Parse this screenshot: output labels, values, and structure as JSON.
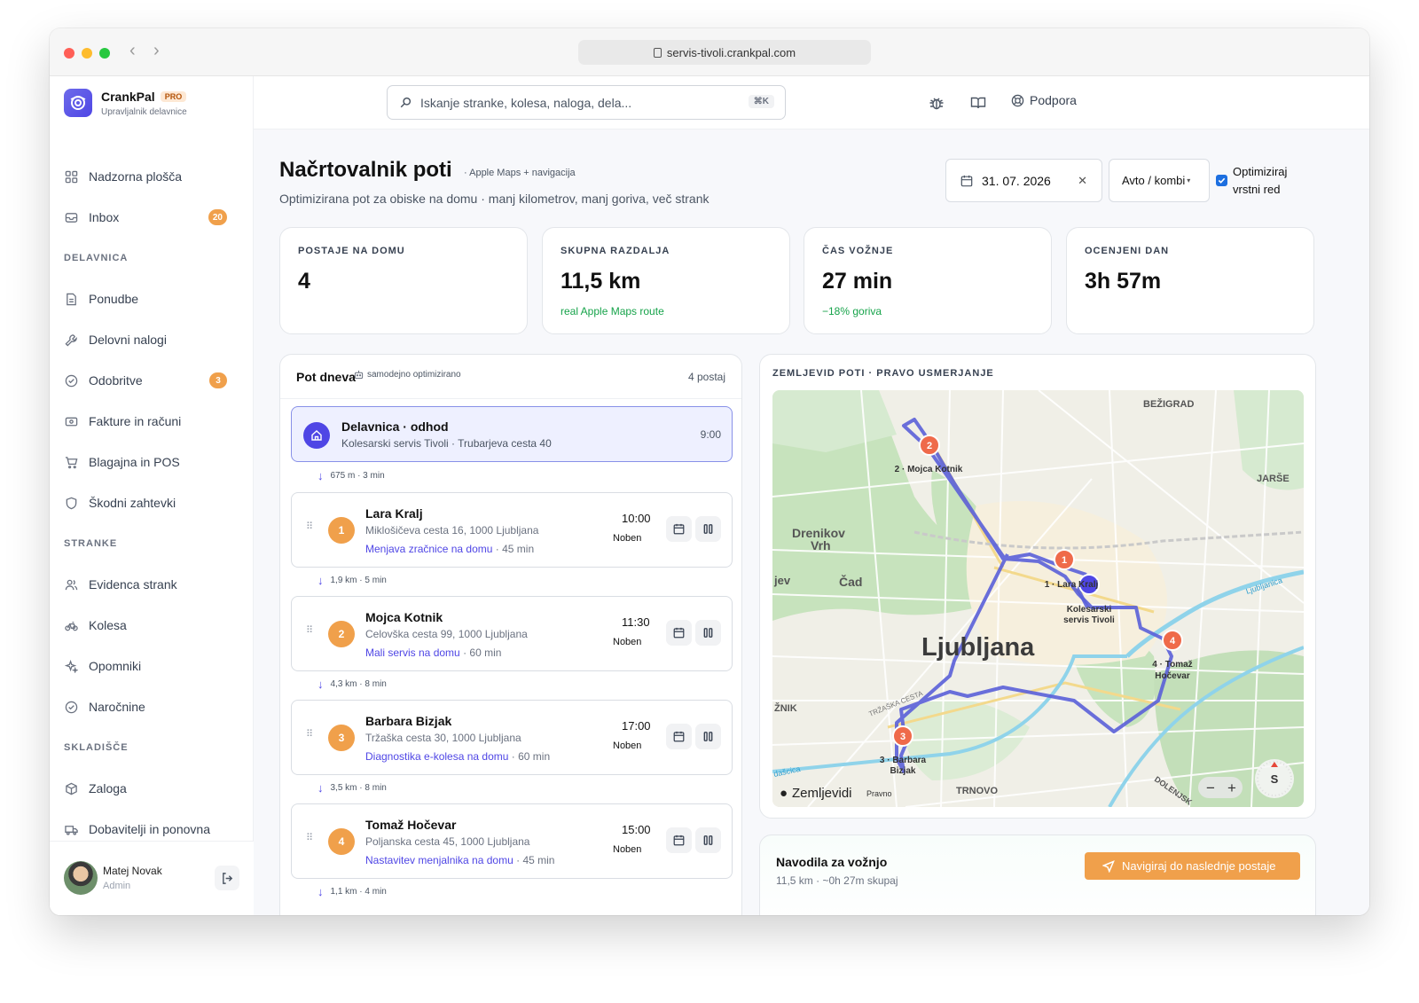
{
  "browser": {
    "url": "servis-tivoli.crankpal.com"
  },
  "brand": {
    "name": "CrankPal",
    "tier": "PRO",
    "subtitle": "Upravljalnik delavnice"
  },
  "sidebar": {
    "items": [
      {
        "label": "Nadzorna plošča",
        "icon": "dashboard-icon"
      },
      {
        "label": "Inbox",
        "icon": "inbox-icon",
        "badge": "20"
      },
      {
        "section": "DELAVNICA"
      },
      {
        "label": "Ponudbe",
        "icon": "document-icon"
      },
      {
        "label": "Delovni nalogi",
        "icon": "wrench-icon"
      },
      {
        "label": "Odobritve",
        "icon": "check-circle-icon",
        "badge": "3"
      },
      {
        "label": "Fakture in računi",
        "icon": "invoice-icon"
      },
      {
        "label": "Blagajna in POS",
        "icon": "cart-icon"
      },
      {
        "label": "Škodni zahtevki",
        "icon": "shield-icon"
      },
      {
        "section": "STRANKE"
      },
      {
        "label": "Evidenca strank",
        "icon": "users-icon"
      },
      {
        "label": "Kolesa",
        "icon": "bike-icon"
      },
      {
        "label": "Opomniki",
        "icon": "sparkle-icon"
      },
      {
        "label": "Naročnine",
        "icon": "check-circle-icon"
      },
      {
        "section": "SKLADIŠČE"
      },
      {
        "label": "Zaloga",
        "icon": "box-icon"
      },
      {
        "label": "Dobavitelji in ponovna",
        "icon": "truck-icon"
      }
    ]
  },
  "user": {
    "name": "Matej Novak",
    "role": "Admin"
  },
  "topbar": {
    "search_placeholder": "Iskanje stranke, kolesa, naloga, dela...",
    "shortcut": "⌘K",
    "support_label": "Podpora"
  },
  "page": {
    "title": "Načrtovalnik poti",
    "title_note": "· Apple Maps + navigacija",
    "subtitle": "Optimizirana pot za obiske na domu · manj kilometrov, manj goriva, več strank",
    "date": "31. 07. 2026",
    "vehicle": "Avto / kombi",
    "optimize_label_1": "Optimiziraj",
    "optimize_label_2": "vrstni red",
    "optimize_checked": true
  },
  "stats": [
    {
      "label": "POSTAJE NA DOMU",
      "value": "4",
      "note": ""
    },
    {
      "label": "SKUPNA RAZDALJA",
      "value": "11,5 km",
      "note": "real Apple Maps route"
    },
    {
      "label": "ČAS VOŽNJE",
      "value": "27 min",
      "note": "−18% goriva"
    },
    {
      "label": "OCENJENI DAN",
      "value": "3h 57m",
      "note": ""
    }
  ],
  "route": {
    "title": "Pot dneva",
    "auto_note": "samodejno optimizirano",
    "count": "4 postaj",
    "depot": {
      "title": "Delavnica · odhod",
      "address": "Kolesarski servis Tivoli · Trubarjeva cesta 40",
      "time": "9:00"
    },
    "legs": [
      "675 m · 3 min",
      "1,9 km · 5 min",
      "4,3 km · 8 min",
      "3,5 km · 8 min",
      "1,1 km · 4 min"
    ],
    "stops": [
      {
        "num": "1",
        "name": "Lara Kralj",
        "address": "Miklošičeva cesta 16, 1000 Ljubljana",
        "service": "Menjava zračnice na domu",
        "duration": "· 45 min",
        "time": "10:00",
        "day": "Noben"
      },
      {
        "num": "2",
        "name": "Mojca Kotnik",
        "address": "Celovška cesta 99, 1000 Ljubljana",
        "service": "Mali servis na domu",
        "duration": "· 60 min",
        "time": "11:30",
        "day": "Noben"
      },
      {
        "num": "3",
        "name": "Barbara Bizjak",
        "address": "Tržaška cesta 30, 1000 Ljubljana",
        "service": "Diagnostika e-kolesa na domu",
        "duration": "· 60 min",
        "time": "17:00",
        "day": "Noben"
      },
      {
        "num": "4",
        "name": "Tomaž Hočevar",
        "address": "Poljanska cesta 45, 1000 Ljubljana",
        "service": "Nastavitev menjalnika na domu",
        "duration": "· 45 min",
        "time": "15:00",
        "day": "Noben"
      }
    ]
  },
  "map": {
    "title": "ZEMLJEVID POTI · PRAVO USMERJANJE",
    "city": "Ljubljana",
    "districts": [
      "BEŽIGRAD",
      "JARŠE",
      "Drenikov",
      "Vrh",
      "Čad",
      "jev",
      "TRNOVO",
      "ŽNIK",
      "DOLENJSK",
      "Ljubljanica",
      "dašcica",
      "TRŽAŠKA CESTA"
    ],
    "markers": [
      {
        "num": "1",
        "label": "1 · Lara Kralj"
      },
      {
        "num": "2",
        "label": "2 · Mojca Kotnik"
      },
      {
        "num": "3",
        "label_1": "3 · Barbara",
        "label_2": "Bizjak"
      },
      {
        "num": "4",
        "label_1": "4 · Tomaž",
        "label_2": "Hočevar"
      }
    ],
    "depot_label_1": "Kolesarski",
    "depot_label_2": "servis Tivoli",
    "attribution": "Zemljevidi",
    "legal": "Pravno",
    "compass": "S",
    "route_color": "#5a5fd8"
  },
  "navigation": {
    "title": "Navodila za vožnjo",
    "summary": "11,5 km · ~0h 27m skupaj",
    "button": "Navigiraj do naslednje postaje"
  },
  "colors": {
    "accent": "#4f46e5",
    "orange": "#f0a04b",
    "marker": "#ef6a4a",
    "success": "#16a34a"
  }
}
